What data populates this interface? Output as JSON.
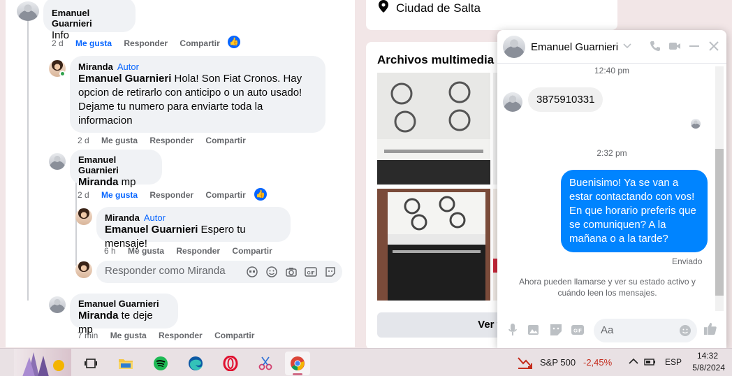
{
  "comments": {
    "c1": {
      "author": "Emanuel Guarnieri",
      "text": "Info",
      "time": "2 d",
      "like": "Me gusta",
      "reply": "Responder",
      "share": "Compartir"
    },
    "r1": {
      "author": "Miranda",
      "badge": "Autor",
      "mention": "Emanuel Guarnieri",
      "text": " Hola! Son Fiat Cronos. Hay opcion de retirarlo con anticipo o un auto usado! Dejame tu numero para enviarte toda la informacion",
      "time": "2 d",
      "like": "Me gusta",
      "reply": "Responder",
      "share": "Compartir"
    },
    "r2": {
      "author": "Emanuel Guarnieri",
      "mention": "Miranda",
      "text": " mp",
      "time": "2 d",
      "like": "Me gusta",
      "reply": "Responder",
      "share": "Compartir"
    },
    "r3": {
      "author": "Miranda",
      "badge": "Autor",
      "mention": "Emanuel Guarnieri",
      "text": " Espero tu mensaje!",
      "time": "6 h",
      "like": "Me gusta",
      "reply": "Responder",
      "share": "Compartir"
    },
    "reply_placeholder": "Responder como Miranda",
    "r4": {
      "author": "Emanuel Guarnieri",
      "mention": "Miranda",
      "text": " te deje mp",
      "time": "7 min",
      "like": "Me gusta",
      "reply": "Responder",
      "share": "Compartir"
    }
  },
  "profile": {
    "location": "Ciudad de Salta",
    "media_title": "Archivos multimedia re",
    "see_all": "Ver to"
  },
  "chat": {
    "contact_name": "Emanuel Guarnieri",
    "time1": "12:40 pm",
    "phone_message": "3875910331",
    "time2": "2:32 pm",
    "outgoing_message": "Buenisimo! Ya se van a estar contactando con vos! En que horario preferis que se comuniquen? A la mañana o a la tarde?",
    "status": "Enviado",
    "system_note": "Ahora pueden llamarse y ver su estado activo y cuándo leen los mensajes.",
    "input_placeholder": "Aa"
  },
  "taskbar": {
    "stock_name": "S&P 500",
    "stock_change": "-2,45%",
    "stock_color": "#c42b1c",
    "language": "ESP",
    "time": "14:32",
    "date": "5/8/2024",
    "apps": [
      "task-view-icon",
      "file-explorer-icon",
      "spotify-icon",
      "edge-icon",
      "opera-icon",
      "snipping-tool-icon",
      "chrome-icon"
    ]
  },
  "colors": {
    "facebook_blue": "#0866ff",
    "messenger_blue": "#0084ff"
  }
}
